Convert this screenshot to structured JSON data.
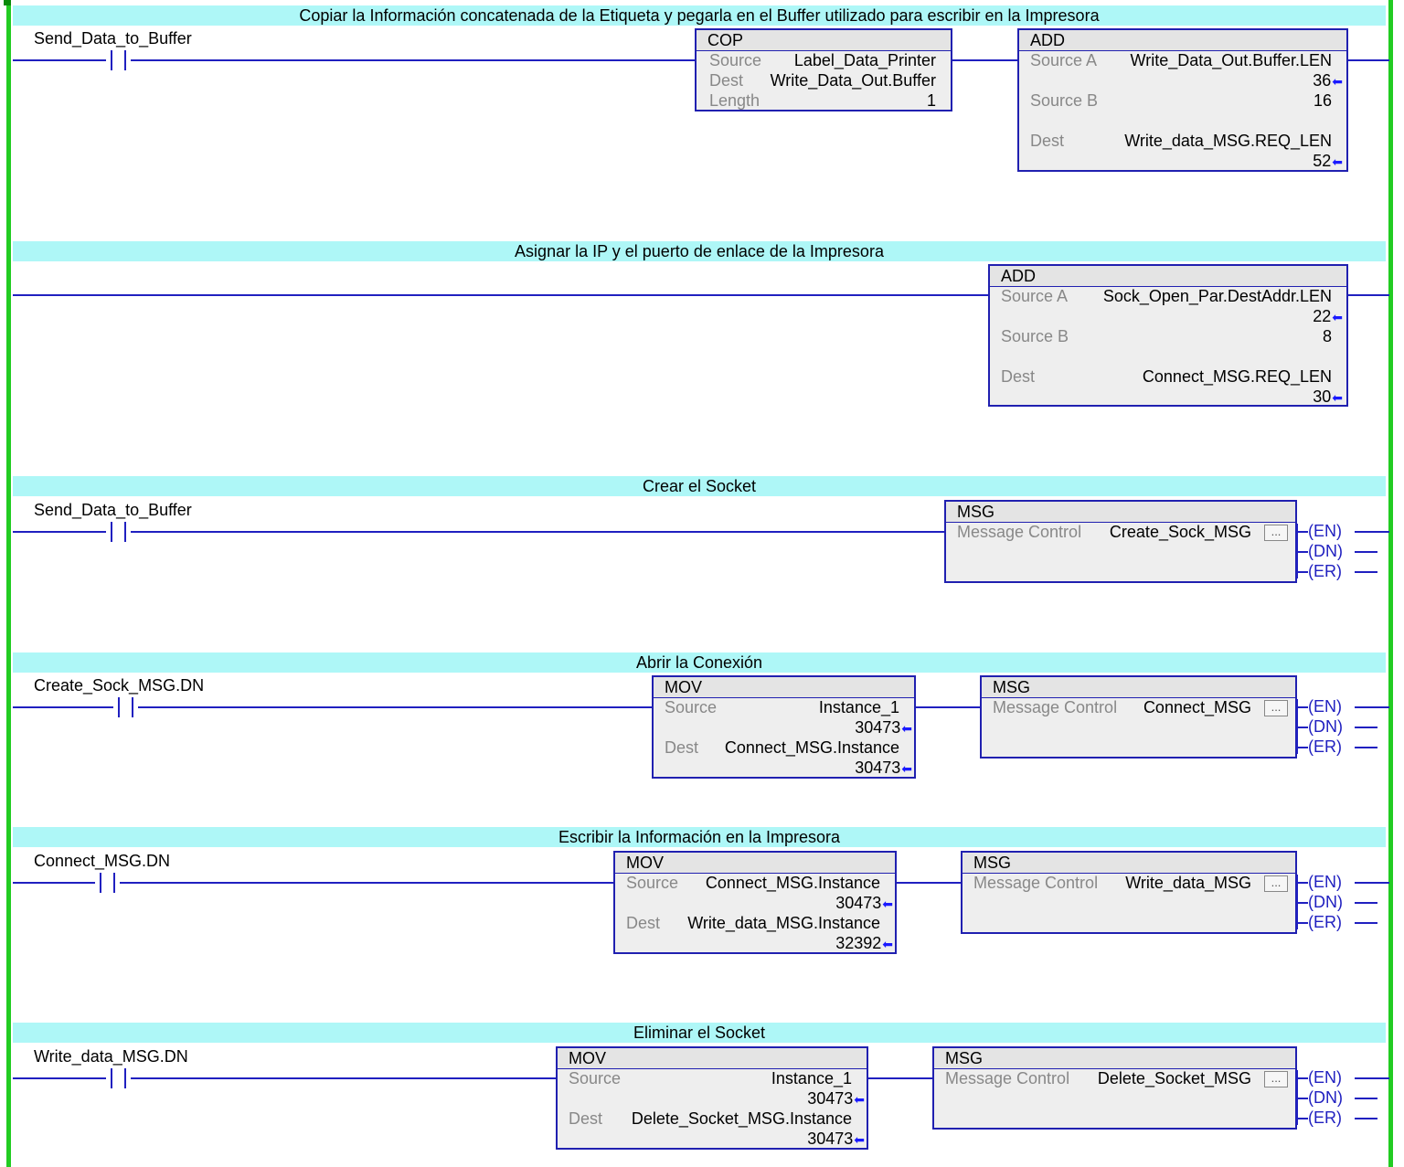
{
  "rungs": [
    {
      "comment": "Copiar la Información concatenada de la Etiqueta y pegarla en el Buffer utilizado para escribir en la Impresora",
      "contact": "Send_Data_to_Buffer",
      "cop": {
        "title": "COP",
        "source_label": "Source",
        "source": "Label_Data_Printer",
        "dest_label": "Dest",
        "dest": "Write_Data_Out.Buffer",
        "length_label": "Length",
        "length": "1"
      },
      "add": {
        "title": "ADD",
        "a_label": "Source A",
        "a": "Write_Data_Out.Buffer.LEN",
        "a_val": "36",
        "b_label": "Source B",
        "b": "16",
        "dest_label": "Dest",
        "dest": "Write_data_MSG.REQ_LEN",
        "dest_val": "52"
      }
    },
    {
      "comment": "Asignar la IP y el puerto de enlace de la Impresora",
      "add": {
        "title": "ADD",
        "a_label": "Source A",
        "a": "Sock_Open_Par.DestAddr.LEN",
        "a_val": "22",
        "b_label": "Source B",
        "b": "8",
        "dest_label": "Dest",
        "dest": "Connect_MSG.REQ_LEN",
        "dest_val": "30"
      }
    },
    {
      "comment": "Crear el Socket",
      "contact": "Send_Data_to_Buffer",
      "msg": {
        "title": "MSG",
        "ctrl_label": "Message Control",
        "ctrl": "Create_Sock_MSG",
        "dots": "..."
      }
    },
    {
      "comment": "Abrir la Conexión",
      "contact": "Create_Sock_MSG.DN",
      "mov": {
        "title": "MOV",
        "source_label": "Source",
        "source": "Instance_1",
        "source_val": "30473",
        "dest_label": "Dest",
        "dest": "Connect_MSG.Instance",
        "dest_val": "30473"
      },
      "msg": {
        "title": "MSG",
        "ctrl_label": "Message Control",
        "ctrl": "Connect_MSG",
        "dots": "..."
      }
    },
    {
      "comment": "Escribir la Información en la Impresora",
      "contact": "Connect_MSG.DN",
      "mov": {
        "title": "MOV",
        "source_label": "Source",
        "source": "Connect_MSG.Instance",
        "source_val": "30473",
        "dest_label": "Dest",
        "dest": "Write_data_MSG.Instance",
        "dest_val": "32392"
      },
      "msg": {
        "title": "MSG",
        "ctrl_label": "Message Control",
        "ctrl": "Write_data_MSG",
        "dots": "..."
      }
    },
    {
      "comment": "Eliminar el Socket",
      "contact": "Write_data_MSG.DN",
      "mov": {
        "title": "MOV",
        "source_label": "Source",
        "source": "Instance_1",
        "source_val": "30473",
        "dest_label": "Dest",
        "dest": "Delete_Socket_MSG.Instance",
        "dest_val": "30473"
      },
      "msg": {
        "title": "MSG",
        "ctrl_label": "Message Control",
        "ctrl": "Delete_Socket_MSG",
        "dots": "..."
      }
    }
  ],
  "coil_labels": {
    "en": "EN",
    "dn": "DN",
    "er": "ER"
  },
  "colors": {
    "rail": "#22cc22",
    "wire": "#2020c0",
    "comment_bg": "#aef7f7",
    "box_bg": "#eeeeee"
  }
}
